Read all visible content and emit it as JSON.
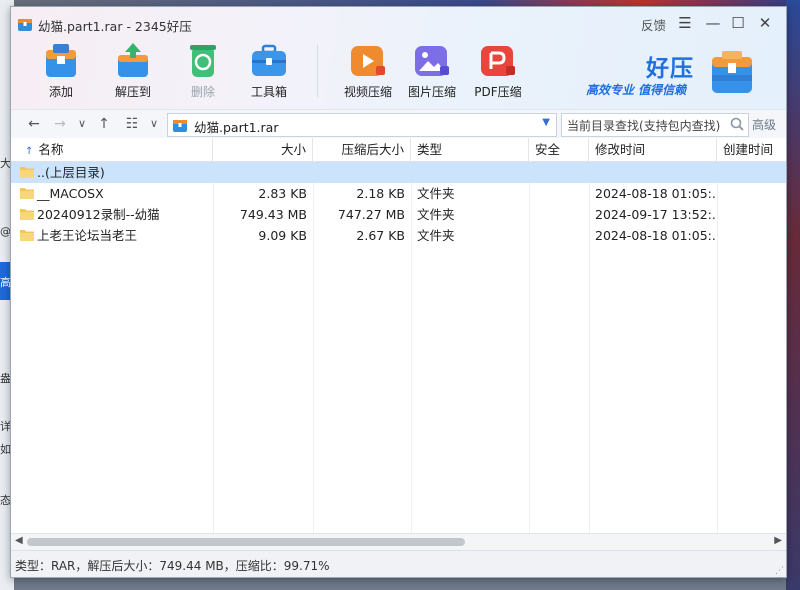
{
  "window": {
    "title": "幼猫.part1.rar - 2345好压",
    "feedback": "反馈",
    "menu_glyph": "☰",
    "minimize_glyph": "—",
    "maximize_glyph": "☐",
    "close_glyph": "✕"
  },
  "toolbar": {
    "add": "添加",
    "extract": "解压到",
    "delete": "删除",
    "tools": "工具箱",
    "video": "视频压缩",
    "image": "图片压缩",
    "pdf": "PDF压缩"
  },
  "brand": {
    "name": "好压",
    "slogan": "高效专业  值得信赖"
  },
  "nav": {
    "back": "←",
    "forward": "→",
    "history": "∨",
    "up": "↑",
    "view": "☷",
    "view_dd": "∨",
    "address": "幼猫.part1.rar",
    "address_dd": "▼",
    "search_placeholder": "当前目录查找(支持包内查找)",
    "advanced": "高级"
  },
  "columns": {
    "name": "名称",
    "sort_arrow": "↑",
    "size": "大小",
    "packed": "压缩后大小",
    "type": "类型",
    "security": "安全",
    "modified": "修改时间",
    "created": "创建时间"
  },
  "rows": [
    {
      "name": "..(上层目录)",
      "size": "",
      "packed": "",
      "type": "",
      "security": "",
      "modified": "",
      "created": ""
    },
    {
      "name": "__MACOSX",
      "size": "2.83 KB",
      "packed": "2.18 KB",
      "type": "文件夹",
      "security": "",
      "modified": "2024-08-18 01:05:...",
      "created": ""
    },
    {
      "name": "20240912录制--幼猫",
      "size": "749.43 MB",
      "packed": "747.27 MB",
      "type": "文件夹",
      "security": "",
      "modified": "2024-09-17 13:52:...",
      "created": ""
    },
    {
      "name": "上老王论坛当老王",
      "size": "9.09 KB",
      "packed": "2.67 KB",
      "type": "文件夹",
      "security": "",
      "modified": "2024-08-18 01:05:...",
      "created": ""
    }
  ],
  "scroll": {
    "left": "◀",
    "right": "▶"
  },
  "status": {
    "text": "类型：RAR，解压后大小：749.44 MB，压缩比：99.71%"
  },
  "colors": {
    "brand_blue": "#1f6fe0",
    "selection": "#cce4fb",
    "folder": "#f3c659"
  },
  "desktop": {
    "frag1": "大",
    "frag2": "高",
    "frag3": "@",
    "frag4": "盎",
    "frag5": "详",
    "frag6": "如",
    "frag7": "态"
  }
}
